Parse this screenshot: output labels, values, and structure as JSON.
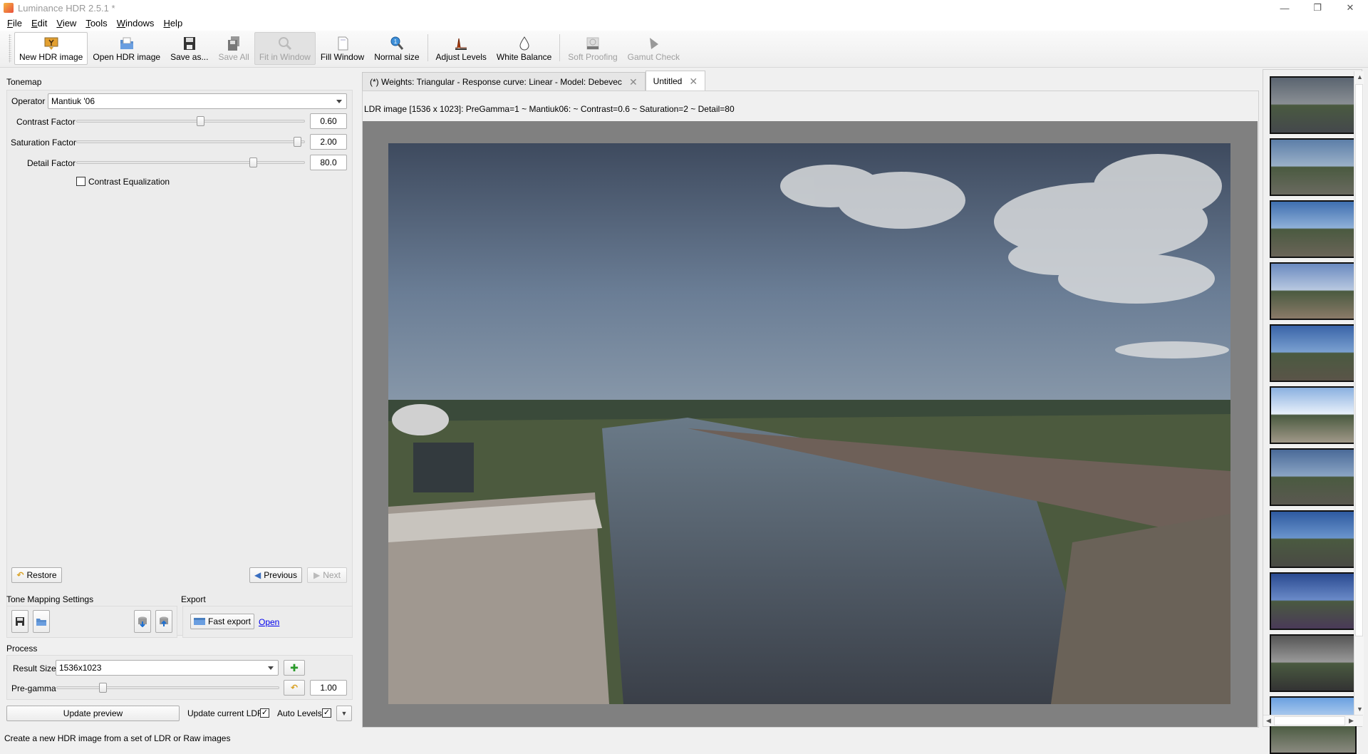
{
  "window": {
    "title": "Luminance HDR 2.5.1 *",
    "controls": {
      "minimize": "—",
      "restore": "❐",
      "close": "✕"
    }
  },
  "menubar": [
    {
      "label": "File",
      "mnemonic": "F",
      "rest": "ile"
    },
    {
      "label": "Edit",
      "mnemonic": "E",
      "rest": "dit"
    },
    {
      "label": "View",
      "mnemonic": "V",
      "rest": "iew"
    },
    {
      "label": "Tools",
      "mnemonic": "T",
      "rest": "ools"
    },
    {
      "label": "Windows",
      "mnemonic": "W",
      "rest": "indows"
    },
    {
      "label": "Help",
      "mnemonic": "H",
      "rest": "elp"
    }
  ],
  "toolbar": [
    {
      "label": "New HDR image",
      "icon": "new-hdr-icon",
      "state": "active"
    },
    {
      "label": "Open HDR image",
      "icon": "open-folder-icon",
      "state": "normal"
    },
    {
      "label": "Save as...",
      "icon": "save-icon",
      "state": "normal"
    },
    {
      "label": "Save All",
      "icon": "save-all-icon",
      "state": "disabled"
    },
    {
      "label": "Fit in Window",
      "icon": "fit-window-icon",
      "state": "pressed"
    },
    {
      "label": "Fill Window",
      "icon": "fill-window-icon",
      "state": "normal"
    },
    {
      "label": "Normal size",
      "icon": "zoom-normal-icon",
      "state": "normal"
    },
    {
      "label": "Adjust Levels",
      "icon": "levels-icon",
      "state": "normal"
    },
    {
      "label": "White Balance",
      "icon": "droplet-icon",
      "state": "normal"
    },
    {
      "label": "Soft Proofing",
      "icon": "soft-proofing-icon",
      "state": "disabled"
    },
    {
      "label": "Gamut Check",
      "icon": "gamut-check-icon",
      "state": "disabled"
    }
  ],
  "tonemap": {
    "section_title": "Tonemap",
    "operator_label": "Operator",
    "operator_value": "Mantiuk '06",
    "contrast_label": "Contrast Factor",
    "contrast_value": "0.60",
    "contrast_fraction": 0.55,
    "saturation_label": "Saturation Factor",
    "saturation_value": "2.00",
    "saturation_fraction": 0.99,
    "detail_label": "Detail Factor",
    "detail_value": "80.0",
    "detail_fraction": 0.79,
    "contrast_eq_label": "Contrast Equalization",
    "contrast_eq_checked": false,
    "restore_label": "Restore",
    "previous_label": "Previous",
    "next_label": "Next"
  },
  "tm_settings": {
    "section_title": "Tone Mapping Settings"
  },
  "export": {
    "section_title": "Export",
    "fast_export_label": "Fast export",
    "open_link": "Open"
  },
  "process": {
    "section_title": "Process",
    "result_size_label": "Result Size",
    "result_size_value": "1536x1023",
    "pregamma_label": "Pre-gamma",
    "pregamma_value": "1.00",
    "pregamma_fraction": 0.2,
    "update_preview_label": "Update preview",
    "update_current_ldr_label": "Update current LDR",
    "update_current_ldr_checked": true,
    "auto_levels_label": "Auto Levels",
    "auto_levels_checked": true
  },
  "tabs": [
    {
      "label": "(*) Weights: Triangular - Response curve: Linear - Model: Debevec",
      "active": false
    },
    {
      "label": "Untitled",
      "active": true
    }
  ],
  "image_info": "LDR image [1536 x 1023]: PreGamma=1 ~ Mantiuk06: ~ Contrast=0.6 ~ Saturation=2 ~ Detail=80",
  "thumbnails": [
    {
      "tone": "desaturated"
    },
    {
      "tone": "natural"
    },
    {
      "tone": "vivid"
    },
    {
      "tone": "warm"
    },
    {
      "tone": "vivid-dark"
    },
    {
      "tone": "bright"
    },
    {
      "tone": "cool"
    },
    {
      "tone": "deep-blue"
    },
    {
      "tone": "saturated"
    },
    {
      "tone": "grayscale"
    },
    {
      "tone": "sky-blue"
    }
  ],
  "statusbar": "Create a new HDR image from a set of LDR or Raw images"
}
